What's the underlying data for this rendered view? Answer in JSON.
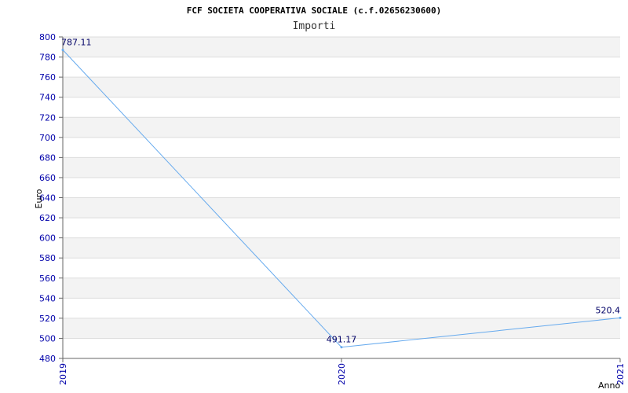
{
  "chart_data": {
    "type": "line",
    "title": "FCF SOCIETA COOPERATIVA SOCIALE (c.f.02656230600)",
    "subtitle": "Importi",
    "xlabel": "Anno",
    "ylabel": "Euro",
    "categories": [
      "2019",
      "2020",
      "2021"
    ],
    "series": [
      {
        "values": [
          787.11,
          491.17,
          520.4
        ],
        "labels": [
          "787.11",
          "491.17",
          "520.4"
        ]
      }
    ],
    "ylim": [
      480,
      800
    ],
    "ytick_step": 20,
    "grid": true,
    "band_colors": [
      "#f3f3f3",
      "#ffffff"
    ],
    "grid_color": "#dddddd",
    "line_color": "#66aaee",
    "tick_color": "#0000aa",
    "label_color": "#000066"
  }
}
